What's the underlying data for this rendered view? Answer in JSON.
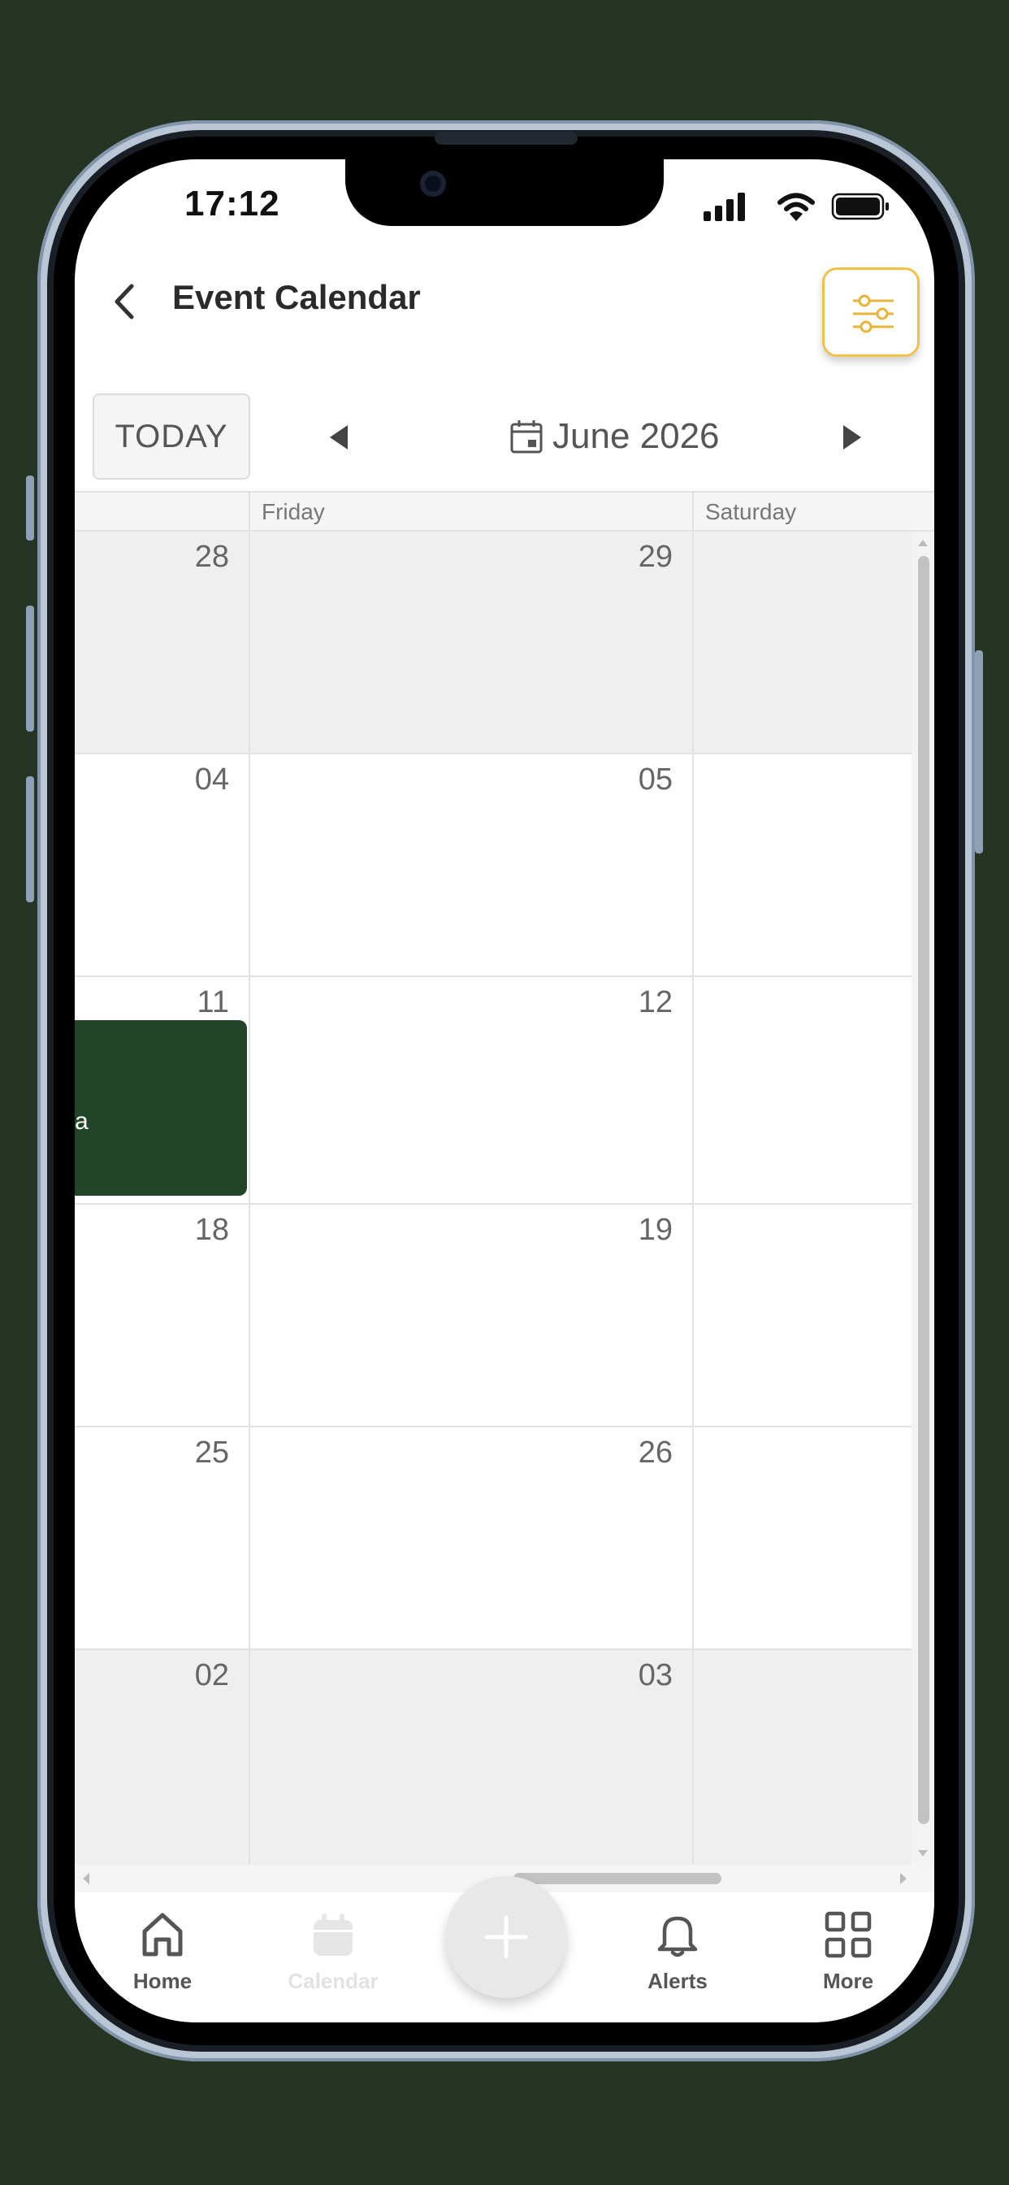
{
  "status_bar": {
    "time": "17:12"
  },
  "header": {
    "title": "Event Calendar"
  },
  "toolbar": {
    "today_label": "TODAY",
    "month_label": "June 2026"
  },
  "calendar": {
    "day_headers": [
      "Friday",
      "Saturday"
    ],
    "weeks": [
      {
        "cells": [
          "28",
          "29"
        ],
        "muted": true
      },
      {
        "cells": [
          "04",
          "05"
        ],
        "muted": false
      },
      {
        "cells": [
          "11",
          "12"
        ],
        "muted": false
      },
      {
        "cells": [
          "18",
          "19"
        ],
        "muted": false
      },
      {
        "cells": [
          "25",
          "26"
        ],
        "muted": false
      },
      {
        "cells": [
          "02",
          "03"
        ],
        "muted": true
      }
    ],
    "event": {
      "text": "a",
      "color": "#224427"
    }
  },
  "bottom_nav": {
    "items": [
      {
        "label": "Home",
        "icon": "home-icon"
      },
      {
        "label": "Calendar",
        "icon": "calendar-icon"
      },
      {
        "label": "Alerts",
        "icon": "bell-icon"
      },
      {
        "label": "More",
        "icon": "grid-icon"
      }
    ],
    "fab_icon": "plus-icon"
  },
  "colors": {
    "accent": "#f1c24a",
    "event_green": "#224427",
    "background": "#263424"
  }
}
